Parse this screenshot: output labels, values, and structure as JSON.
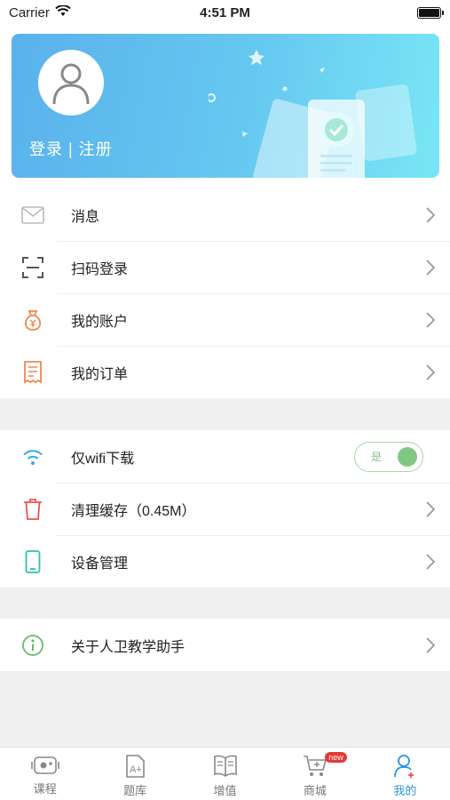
{
  "status_bar": {
    "carrier": "Carrier",
    "time": "4:51 PM"
  },
  "profile": {
    "login_text": "登录 | 注册"
  },
  "menu_group1": [
    {
      "label": "消息",
      "icon": "mail-icon"
    },
    {
      "label": "扫码登录",
      "icon": "scan-icon"
    },
    {
      "label": "我的账户",
      "icon": "money-bag-icon"
    },
    {
      "label": "我的订单",
      "icon": "receipt-icon"
    }
  ],
  "menu_group2": [
    {
      "label": "仅wifi下载",
      "icon": "wifi-icon",
      "toggle_text": "是",
      "toggle_on": true
    },
    {
      "label": "清理缓存（0.45M）",
      "icon": "trash-icon"
    },
    {
      "label": "设备管理",
      "icon": "phone-icon"
    }
  ],
  "menu_group3": [
    {
      "label": "关于人卫教学助手",
      "icon": "info-icon"
    }
  ],
  "tabs": [
    {
      "label": "课程",
      "icon": "course-icon"
    },
    {
      "label": "题库",
      "icon": "question-bank-icon"
    },
    {
      "label": "增值",
      "icon": "book-icon"
    },
    {
      "label": "商城",
      "icon": "cart-icon",
      "badge": "new"
    },
    {
      "label": "我的",
      "icon": "user-icon",
      "active": true
    }
  ],
  "colors": {
    "accent": "#2a95e6",
    "banner_start": "#5ab1ec",
    "banner_end": "#79e6f5",
    "toggle": "#81c784"
  }
}
